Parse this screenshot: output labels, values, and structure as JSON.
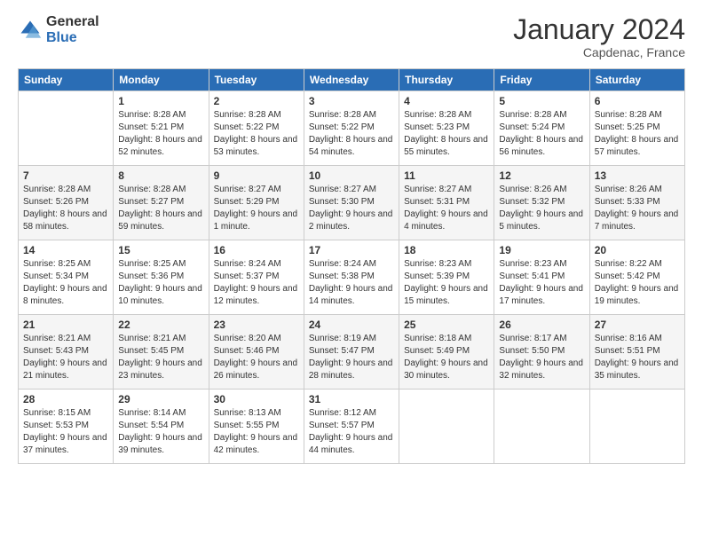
{
  "logo": {
    "general": "General",
    "blue": "Blue"
  },
  "header": {
    "title": "January 2024",
    "location": "Capdenac, France"
  },
  "days_of_week": [
    "Sunday",
    "Monday",
    "Tuesday",
    "Wednesday",
    "Thursday",
    "Friday",
    "Saturday"
  ],
  "weeks": [
    [
      {
        "day": "",
        "sunrise": "",
        "sunset": "",
        "daylight": ""
      },
      {
        "day": "1",
        "sunrise": "Sunrise: 8:28 AM",
        "sunset": "Sunset: 5:21 PM",
        "daylight": "Daylight: 8 hours and 52 minutes."
      },
      {
        "day": "2",
        "sunrise": "Sunrise: 8:28 AM",
        "sunset": "Sunset: 5:22 PM",
        "daylight": "Daylight: 8 hours and 53 minutes."
      },
      {
        "day": "3",
        "sunrise": "Sunrise: 8:28 AM",
        "sunset": "Sunset: 5:22 PM",
        "daylight": "Daylight: 8 hours and 54 minutes."
      },
      {
        "day": "4",
        "sunrise": "Sunrise: 8:28 AM",
        "sunset": "Sunset: 5:23 PM",
        "daylight": "Daylight: 8 hours and 55 minutes."
      },
      {
        "day": "5",
        "sunrise": "Sunrise: 8:28 AM",
        "sunset": "Sunset: 5:24 PM",
        "daylight": "Daylight: 8 hours and 56 minutes."
      },
      {
        "day": "6",
        "sunrise": "Sunrise: 8:28 AM",
        "sunset": "Sunset: 5:25 PM",
        "daylight": "Daylight: 8 hours and 57 minutes."
      }
    ],
    [
      {
        "day": "7",
        "sunrise": "Sunrise: 8:28 AM",
        "sunset": "Sunset: 5:26 PM",
        "daylight": "Daylight: 8 hours and 58 minutes."
      },
      {
        "day": "8",
        "sunrise": "Sunrise: 8:28 AM",
        "sunset": "Sunset: 5:27 PM",
        "daylight": "Daylight: 8 hours and 59 minutes."
      },
      {
        "day": "9",
        "sunrise": "Sunrise: 8:27 AM",
        "sunset": "Sunset: 5:29 PM",
        "daylight": "Daylight: 9 hours and 1 minute."
      },
      {
        "day": "10",
        "sunrise": "Sunrise: 8:27 AM",
        "sunset": "Sunset: 5:30 PM",
        "daylight": "Daylight: 9 hours and 2 minutes."
      },
      {
        "day": "11",
        "sunrise": "Sunrise: 8:27 AM",
        "sunset": "Sunset: 5:31 PM",
        "daylight": "Daylight: 9 hours and 4 minutes."
      },
      {
        "day": "12",
        "sunrise": "Sunrise: 8:26 AM",
        "sunset": "Sunset: 5:32 PM",
        "daylight": "Daylight: 9 hours and 5 minutes."
      },
      {
        "day": "13",
        "sunrise": "Sunrise: 8:26 AM",
        "sunset": "Sunset: 5:33 PM",
        "daylight": "Daylight: 9 hours and 7 minutes."
      }
    ],
    [
      {
        "day": "14",
        "sunrise": "Sunrise: 8:25 AM",
        "sunset": "Sunset: 5:34 PM",
        "daylight": "Daylight: 9 hours and 8 minutes."
      },
      {
        "day": "15",
        "sunrise": "Sunrise: 8:25 AM",
        "sunset": "Sunset: 5:36 PM",
        "daylight": "Daylight: 9 hours and 10 minutes."
      },
      {
        "day": "16",
        "sunrise": "Sunrise: 8:24 AM",
        "sunset": "Sunset: 5:37 PM",
        "daylight": "Daylight: 9 hours and 12 minutes."
      },
      {
        "day": "17",
        "sunrise": "Sunrise: 8:24 AM",
        "sunset": "Sunset: 5:38 PM",
        "daylight": "Daylight: 9 hours and 14 minutes."
      },
      {
        "day": "18",
        "sunrise": "Sunrise: 8:23 AM",
        "sunset": "Sunset: 5:39 PM",
        "daylight": "Daylight: 9 hours and 15 minutes."
      },
      {
        "day": "19",
        "sunrise": "Sunrise: 8:23 AM",
        "sunset": "Sunset: 5:41 PM",
        "daylight": "Daylight: 9 hours and 17 minutes."
      },
      {
        "day": "20",
        "sunrise": "Sunrise: 8:22 AM",
        "sunset": "Sunset: 5:42 PM",
        "daylight": "Daylight: 9 hours and 19 minutes."
      }
    ],
    [
      {
        "day": "21",
        "sunrise": "Sunrise: 8:21 AM",
        "sunset": "Sunset: 5:43 PM",
        "daylight": "Daylight: 9 hours and 21 minutes."
      },
      {
        "day": "22",
        "sunrise": "Sunrise: 8:21 AM",
        "sunset": "Sunset: 5:45 PM",
        "daylight": "Daylight: 9 hours and 23 minutes."
      },
      {
        "day": "23",
        "sunrise": "Sunrise: 8:20 AM",
        "sunset": "Sunset: 5:46 PM",
        "daylight": "Daylight: 9 hours and 26 minutes."
      },
      {
        "day": "24",
        "sunrise": "Sunrise: 8:19 AM",
        "sunset": "Sunset: 5:47 PM",
        "daylight": "Daylight: 9 hours and 28 minutes."
      },
      {
        "day": "25",
        "sunrise": "Sunrise: 8:18 AM",
        "sunset": "Sunset: 5:49 PM",
        "daylight": "Daylight: 9 hours and 30 minutes."
      },
      {
        "day": "26",
        "sunrise": "Sunrise: 8:17 AM",
        "sunset": "Sunset: 5:50 PM",
        "daylight": "Daylight: 9 hours and 32 minutes."
      },
      {
        "day": "27",
        "sunrise": "Sunrise: 8:16 AM",
        "sunset": "Sunset: 5:51 PM",
        "daylight": "Daylight: 9 hours and 35 minutes."
      }
    ],
    [
      {
        "day": "28",
        "sunrise": "Sunrise: 8:15 AM",
        "sunset": "Sunset: 5:53 PM",
        "daylight": "Daylight: 9 hours and 37 minutes."
      },
      {
        "day": "29",
        "sunrise": "Sunrise: 8:14 AM",
        "sunset": "Sunset: 5:54 PM",
        "daylight": "Daylight: 9 hours and 39 minutes."
      },
      {
        "day": "30",
        "sunrise": "Sunrise: 8:13 AM",
        "sunset": "Sunset: 5:55 PM",
        "daylight": "Daylight: 9 hours and 42 minutes."
      },
      {
        "day": "31",
        "sunrise": "Sunrise: 8:12 AM",
        "sunset": "Sunset: 5:57 PM",
        "daylight": "Daylight: 9 hours and 44 minutes."
      },
      {
        "day": "",
        "sunrise": "",
        "sunset": "",
        "daylight": ""
      },
      {
        "day": "",
        "sunrise": "",
        "sunset": "",
        "daylight": ""
      },
      {
        "day": "",
        "sunrise": "",
        "sunset": "",
        "daylight": ""
      }
    ]
  ]
}
